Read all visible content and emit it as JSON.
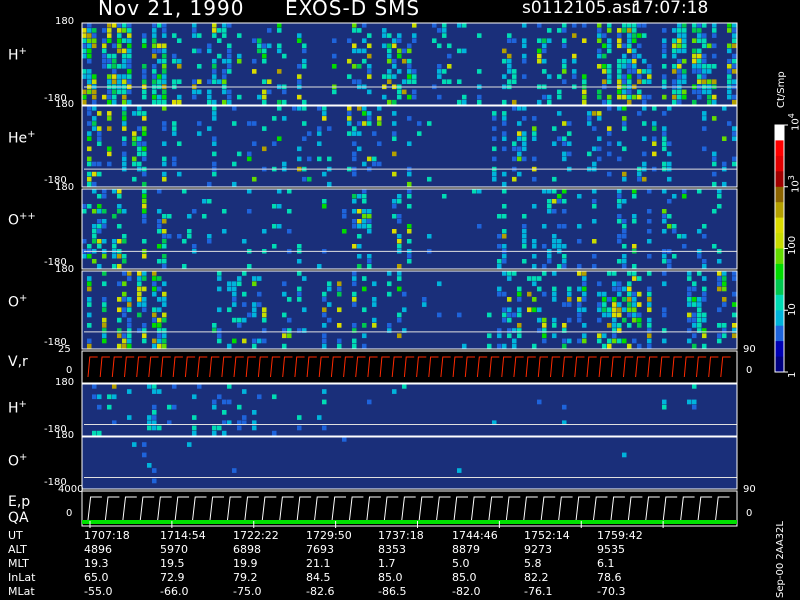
{
  "header": {
    "date": "Nov 21, 1990",
    "mission": "EXOS-D SMS",
    "file": "s0112105.asr",
    "time": "17:07:18"
  },
  "colorbar": {
    "label": "Ct/Smp",
    "tick_labels": [
      "10^4",
      "10^3",
      "100",
      "10",
      "1"
    ],
    "ticks": [
      {
        "label": "1",
        "value": 1
      },
      {
        "label": "10",
        "value": 10
      },
      {
        "label": "100",
        "value": 100
      },
      {
        "label": "10",
        "exp": "3",
        "value": 1000
      },
      {
        "label": "10",
        "exp": "4",
        "value": 10000
      }
    ],
    "colors": [
      "#000080",
      "#0000b4",
      "#1e64dc",
      "#00b4dc",
      "#00dcb4",
      "#00c850",
      "#00dc00",
      "#64dc00",
      "#c8dc00",
      "#dcdc00",
      "#b4a000",
      "#8c6400",
      "#a00000",
      "#e00000",
      "#ff0000",
      "#ffffff"
    ]
  },
  "chart_data": {
    "type": "heatmap",
    "title": "Nov 21, 1990 EXOS-D SMS",
    "time_axis": [
      "1707:18",
      "1714:54",
      "1722:22",
      "1729:50",
      "1737:18",
      "1744:46",
      "1752:14",
      "1759:42"
    ],
    "panels": [
      {
        "id": "h-plus-1",
        "label": "H",
        "sup": "+",
        "y_top": "180",
        "y_bottom": "-180",
        "y_range": [
          -180,
          180
        ],
        "activity": [
          0.95,
          0.55,
          0.45,
          0.5,
          0.35,
          0.5,
          0.75,
          0.9
        ],
        "bright": [
          0.95,
          0.3,
          0.7,
          0.75,
          0.1,
          0.4,
          0.8,
          0.6
        ]
      },
      {
        "id": "he-plus",
        "label": "He",
        "sup": "+",
        "y_top": "180",
        "y_bottom": "-180",
        "y_range": [
          -180,
          180
        ],
        "activity": [
          0.6,
          0.25,
          0.3,
          0.45,
          0.1,
          0.4,
          0.5,
          0.4
        ],
        "bright": [
          0.7,
          0.1,
          0.2,
          0.4,
          0.05,
          0.2,
          0.3,
          0.2
        ]
      },
      {
        "id": "o-plus-plus",
        "label": "O",
        "sup": "++",
        "y_top": "180",
        "y_bottom": "-180",
        "y_range": [
          -180,
          180
        ],
        "activity": [
          0.6,
          0.25,
          0.3,
          0.45,
          0.1,
          0.45,
          0.55,
          0.35
        ],
        "bright": [
          0.75,
          0.1,
          0.2,
          0.35,
          0.05,
          0.2,
          0.3,
          0.2
        ]
      },
      {
        "id": "o-plus-1",
        "label": "O",
        "sup": "+",
        "y_top": "180",
        "y_bottom": "-180",
        "y_range": [
          -180,
          180
        ],
        "activity": [
          0.7,
          0.4,
          0.4,
          0.55,
          0.15,
          0.5,
          0.65,
          0.7
        ],
        "bright": [
          0.8,
          0.3,
          0.3,
          0.5,
          0.05,
          0.3,
          0.5,
          0.5
        ]
      },
      {
        "id": "h-plus-2",
        "label": "H",
        "sup": "+",
        "y_top": "180",
        "y_bottom": "-180",
        "y_range": [
          -180,
          180
        ],
        "activity": [
          0.4,
          0.35,
          0.2,
          0.05,
          0.02,
          0.02,
          0.02,
          0.15
        ],
        "bright": [
          0.1,
          0.1,
          0.05,
          0,
          0,
          0,
          0,
          0
        ]
      },
      {
        "id": "o-plus-2",
        "label": "O",
        "sup": "+",
        "y_top": "180",
        "y_bottom": "-180",
        "y_range": [
          -180,
          180
        ],
        "activity": [
          0.15,
          0.02,
          0.02,
          0.02,
          0.02,
          0.02,
          0.02,
          0.02
        ],
        "bright": [
          0,
          0,
          0,
          0,
          0,
          0,
          0,
          0
        ]
      }
    ],
    "line_panels": [
      {
        "id": "vr",
        "label": "V,r",
        "y_top": "25",
        "y_bottom": "0",
        "right_label": "90",
        "right_bottom": "0",
        "line_color": "#ff2a00",
        "cycles": 53
      },
      {
        "id": "ep",
        "label": "E,p",
        "label2": "QA",
        "y_top": "4000",
        "y_bottom": "0",
        "right_label": "90",
        "right_bottom": "0",
        "line_color": "#ffffff",
        "cycles": 37
      }
    ]
  },
  "footer": {
    "rows": [
      {
        "label": "UT",
        "values": [
          "1707:18",
          "1714:54",
          "1722:22",
          "1729:50",
          "1737:18",
          "1744:46",
          "1752:14",
          "1759:42"
        ]
      },
      {
        "label": "ALT",
        "values": [
          "4896",
          "5970",
          "6898",
          "7693",
          "8353",
          "8879",
          "9273",
          "9535"
        ]
      },
      {
        "label": "MLT",
        "values": [
          "19.3",
          "19.5",
          "19.9",
          "21.1",
          "1.7",
          "5.0",
          "5.8",
          "6.1"
        ]
      },
      {
        "label": "InLat",
        "values": [
          "65.0",
          "72.9",
          "79.2",
          "84.5",
          "85.0",
          "85.0",
          "82.2",
          "78.6"
        ]
      },
      {
        "label": "MLat",
        "values": [
          "-55.0",
          "-66.0",
          "-75.0",
          "-82.6",
          "-86.5",
          "-82.0",
          "-76.1",
          "-70.3"
        ]
      }
    ],
    "plot_id": "Sep-00 2AA32L"
  }
}
